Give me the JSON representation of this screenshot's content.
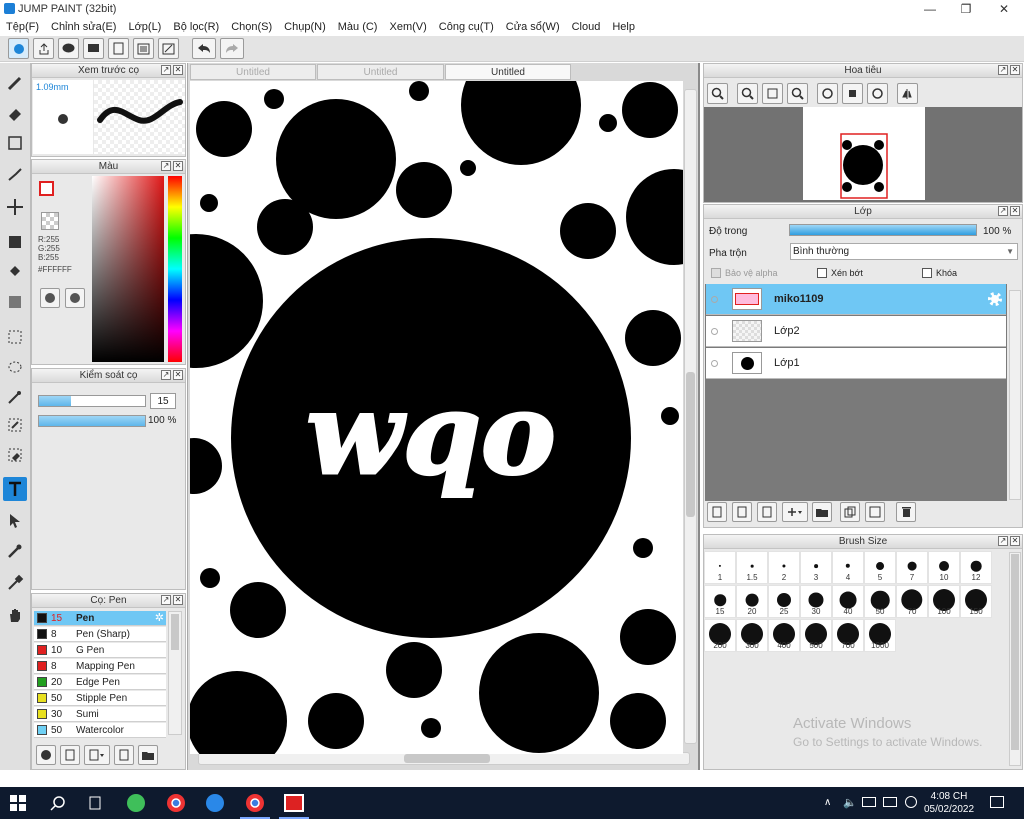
{
  "window": {
    "title": "JUMP PAINT (32bit)"
  },
  "menu": [
    "Tệp(F)",
    "Chỉnh sửa(E)",
    "Lớp(L)",
    "Bộ lọc(R)",
    "Chọn(S)",
    "Chụp(N)",
    "Màu (C)",
    "Xem(V)",
    "Công cụ(T)",
    "Cửa sổ(W)",
    "Cloud",
    "Help"
  ],
  "doc_tabs": [
    "Untitled",
    "Untitled",
    "Untitled"
  ],
  "brush_preview": {
    "title": "Xem trước cọ",
    "size": "1.09mm"
  },
  "color": {
    "title": "Màu",
    "r": "R:255",
    "g": "G:255",
    "b": "B:255",
    "hex": "#FFFFFF"
  },
  "brush_control": {
    "title": "Kiểm soát cọ",
    "size_value": "15",
    "opacity_value": "100 %"
  },
  "brush_list": {
    "title": "Cọ: Pen",
    "items": [
      {
        "size": "15",
        "name": "Pen",
        "color": "#111111"
      },
      {
        "size": "8",
        "name": "Pen (Sharp)",
        "color": "#111111"
      },
      {
        "size": "10",
        "name": "G Pen",
        "color": "#e02020"
      },
      {
        "size": "8",
        "name": "Mapping Pen",
        "color": "#e02020"
      },
      {
        "size": "20",
        "name": "Edge Pen",
        "color": "#22a020"
      },
      {
        "size": "50",
        "name": "Stipple Pen",
        "color": "#e8e020"
      },
      {
        "size": "30",
        "name": "Sumi",
        "color": "#e8e020"
      },
      {
        "size": "50",
        "name": "Watercolor",
        "color": "#6fd0f4"
      }
    ]
  },
  "navigator": {
    "title": "Hoa tiêu"
  },
  "layers": {
    "title": "Lớp",
    "opacity_label": "Độ trong",
    "opacity_value": "100 %",
    "blend_label": "Pha trộn",
    "blend_value": "Bình thường",
    "protect_alpha": "Bảo vệ alpha",
    "clipping": "Xén bớt",
    "lock": "Khóa",
    "items": [
      {
        "name": "miko1109"
      },
      {
        "name": "Lớp2"
      },
      {
        "name": "Lớp1"
      }
    ]
  },
  "brush_size": {
    "title": "Brush Size",
    "sizes": [
      "1",
      "1.5",
      "2",
      "3",
      "4",
      "5",
      "7",
      "10",
      "12",
      "15",
      "20",
      "25",
      "30",
      "40",
      "50",
      "70",
      "100",
      "150",
      "200",
      "300",
      "400",
      "500",
      "700",
      "1000"
    ]
  },
  "canvas_text": "wqo",
  "watermark": {
    "line1": "Activate Windows",
    "line2": "Go to Settings to activate Windows."
  },
  "taskbar": {
    "time": "4:08 CH",
    "date": "05/02/2022"
  }
}
